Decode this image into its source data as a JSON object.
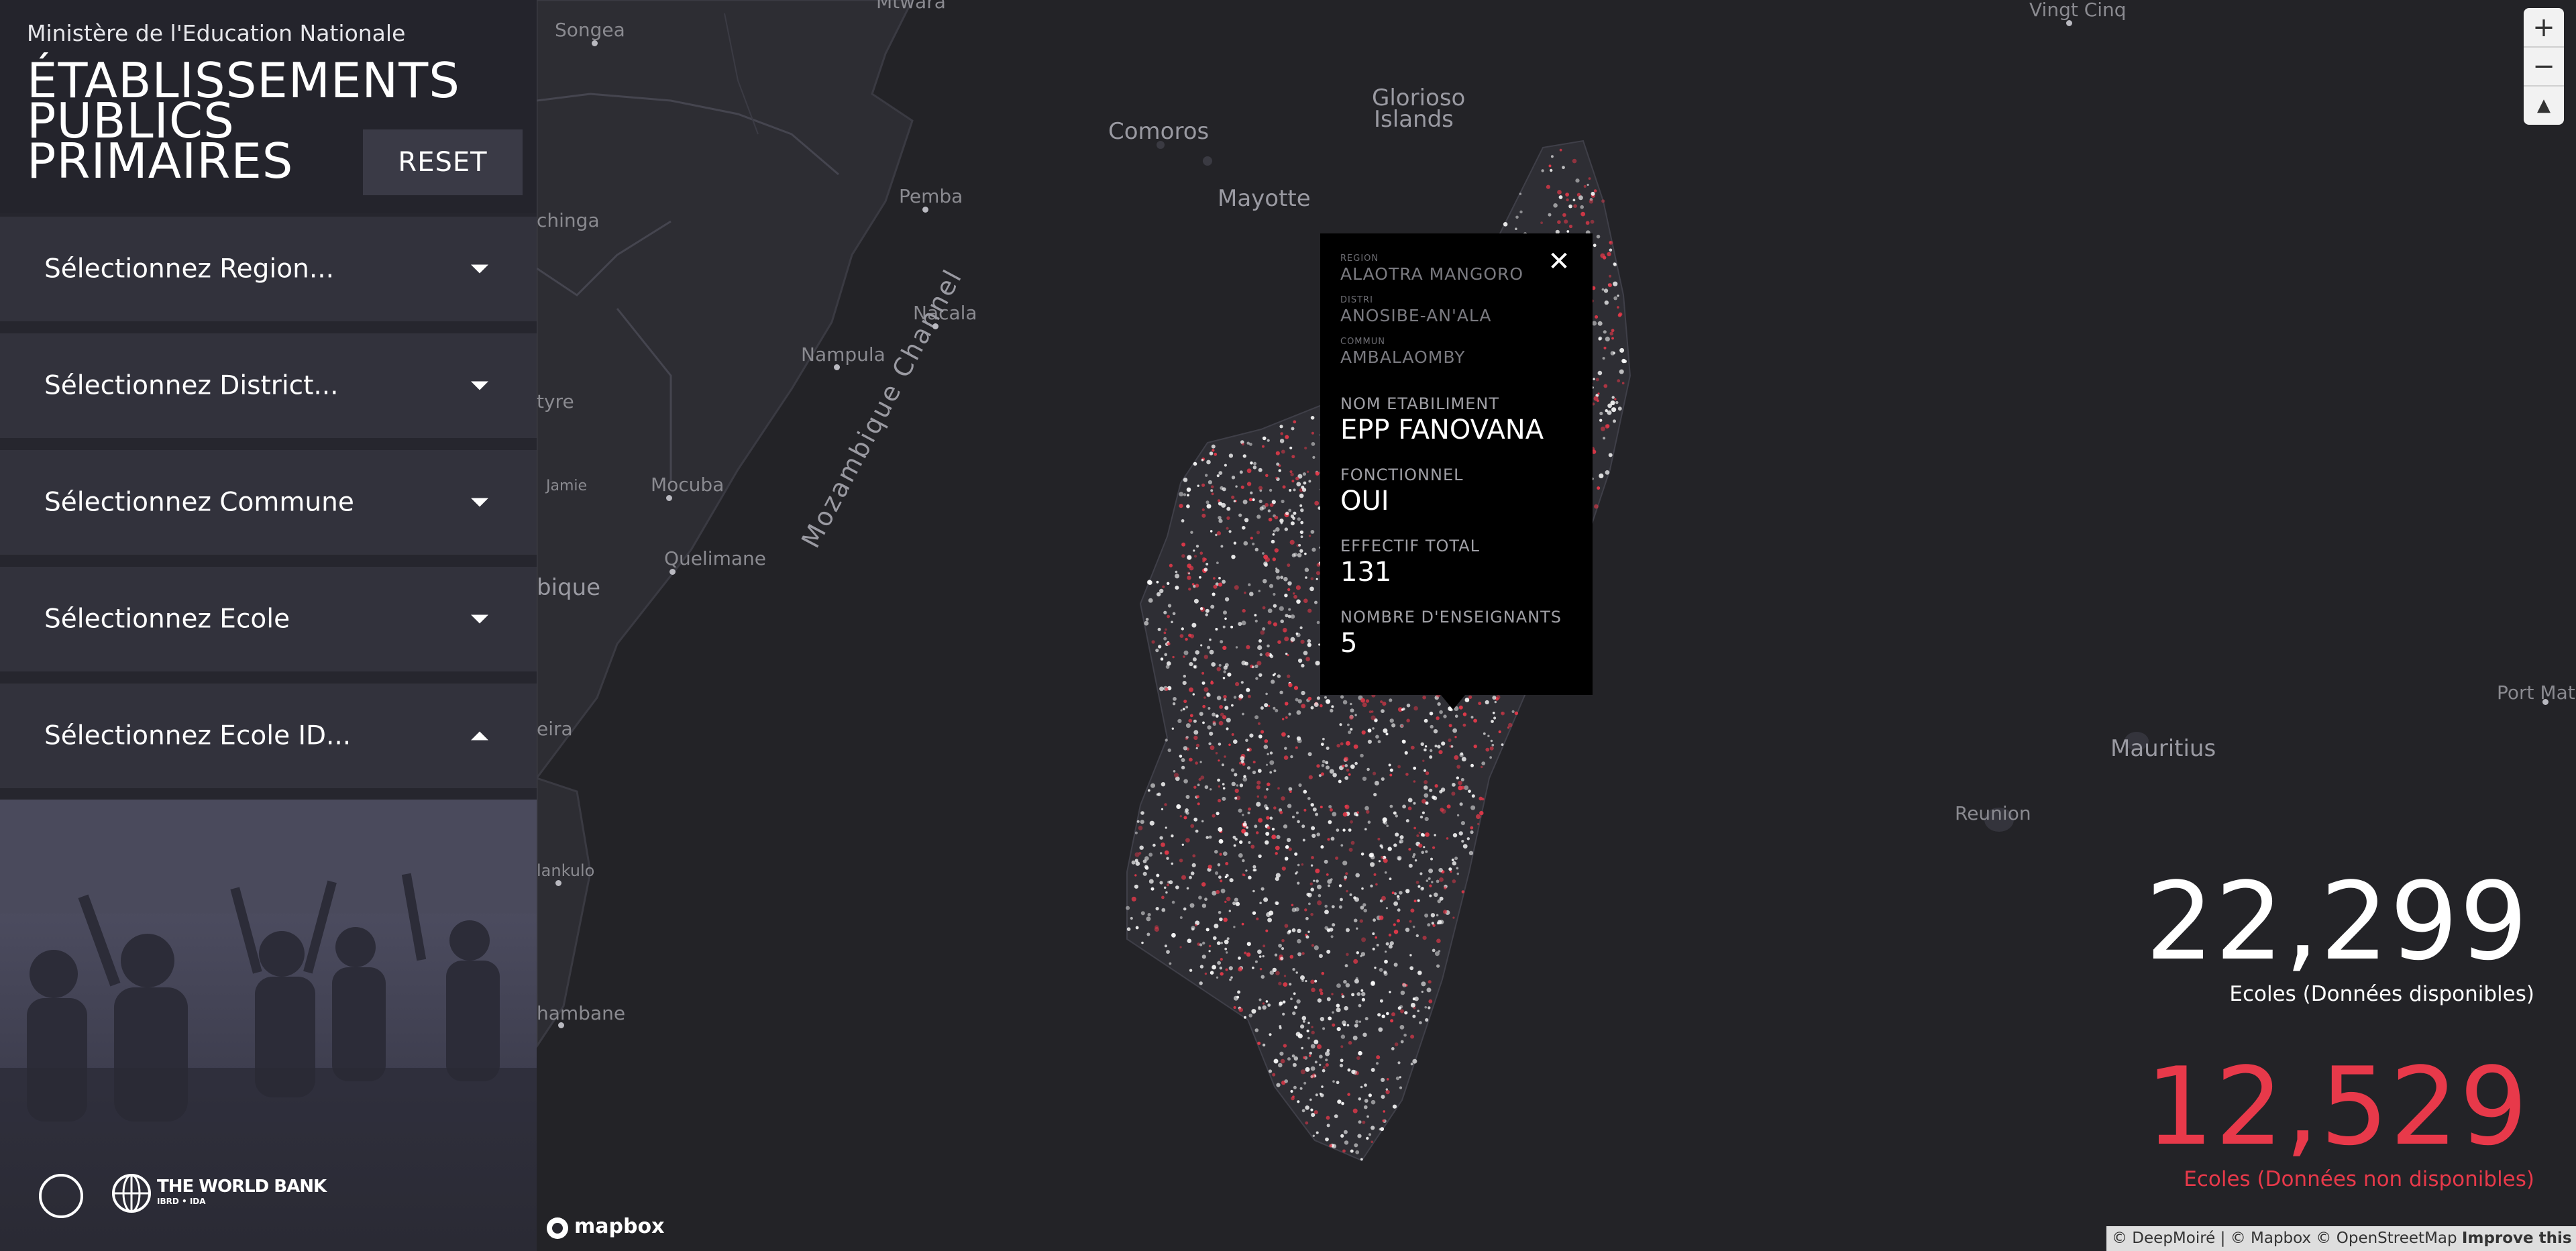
{
  "sidebar": {
    "ministry": "Ministère de l'Education Nationale",
    "title_lines": [
      "ÉTABLISSEMENTS",
      "PUBLICS",
      "PRIMAIRES"
    ],
    "reset_label": "RESET",
    "dropdowns": [
      {
        "label": "Sélectionnez Region...",
        "arrow": "down"
      },
      {
        "label": "Sélectionnez District...",
        "arrow": "down"
      },
      {
        "label": "Sélectionnez Commune",
        "arrow": "down"
      },
      {
        "label": "Sélectionnez Ecole",
        "arrow": "down"
      },
      {
        "label": "Sélectionnez Ecole ID...",
        "arrow": "up"
      }
    ],
    "footer": {
      "wb_name": "THE WORLD BANK",
      "wb_sub": "IBRD • IDA"
    }
  },
  "map": {
    "labels": [
      {
        "text": "Songea"
      },
      {
        "text": "Mtwara"
      },
      {
        "text": "Vingt Cinq"
      },
      {
        "text": "Glorioso"
      },
      {
        "text": "Islands"
      },
      {
        "text": "Comoros"
      },
      {
        "text": "Mayotte"
      },
      {
        "text": "Pemba"
      },
      {
        "text": "Nacala"
      },
      {
        "text": "Nampula"
      },
      {
        "text": "chinga"
      },
      {
        "text": "tyre"
      },
      {
        "text": "Mocuba"
      },
      {
        "text": "Quelimane"
      },
      {
        "text": "bique"
      },
      {
        "text": "Mozambique Channel"
      },
      {
        "text": "eira"
      },
      {
        "text": "lankulo"
      },
      {
        "text": "hambane"
      },
      {
        "text": "Port Math"
      },
      {
        "text": "Mauritius"
      },
      {
        "text": "Reunion"
      },
      {
        "text": "Jamie"
      }
    ],
    "popup": {
      "region_key": "REGION",
      "region_val": "ALAOTRA MANGORO",
      "district_key": "DISTRI",
      "district_val": "ANOSIBE-AN'ALA",
      "commune_key": "COMMUN",
      "commune_val": "AMBALAOMBY",
      "fields": [
        {
          "key": "NOM ETABILIMENT",
          "value": "EPP FANOVANA"
        },
        {
          "key": "FONCTIONNEL",
          "value": "OUI"
        },
        {
          "key": "EFFECTIF TOTAL",
          "value": "131"
        },
        {
          "key": "NOMBRE D'ENSEIGNANTS",
          "value": "5"
        }
      ],
      "close": "✕"
    },
    "stats": {
      "available_count": "22,299",
      "available_label": "Ecoles (Données disponibles)",
      "unavailable_count": "12,529",
      "unavailable_label": "Ecoles (Données non disponibles)"
    },
    "zoom": {
      "in": "+",
      "out": "−",
      "compass": "▲"
    },
    "attribution": {
      "text": "© DeepMoiré | © Mapbox © OpenStreetMap",
      "improve": "Improve this map"
    },
    "mapbox_logo": "mapbox"
  },
  "colors": {
    "available": "#ffffff",
    "unavailable": "#e8394a",
    "background": "#232327"
  }
}
